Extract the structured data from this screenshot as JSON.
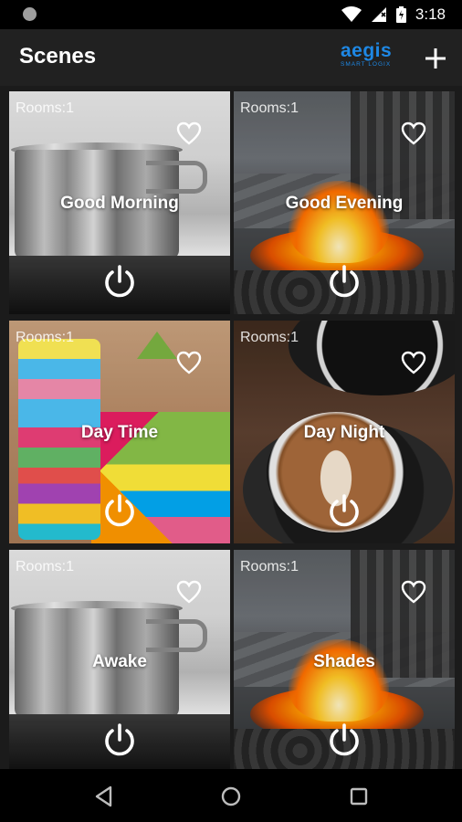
{
  "status_bar": {
    "time": "3:18"
  },
  "app_bar": {
    "title": "Scenes",
    "logo_main": "aegis",
    "logo_sub": "SMART LOGIX",
    "accent_color": "#1e88e5"
  },
  "scenes": [
    {
      "rooms": "Rooms:1",
      "name": "Good Morning",
      "image": "pot-on-stove"
    },
    {
      "rooms": "Rooms:1",
      "name": "Good Evening",
      "image": "fire-pit"
    },
    {
      "rooms": "Rooms:1",
      "name": "Day Time",
      "image": "toy-blocks"
    },
    {
      "rooms": "Rooms:1",
      "name": "Day Night",
      "image": "latte-cup"
    },
    {
      "rooms": "Rooms:1",
      "name": "Awake",
      "image": "pot-on-stove"
    },
    {
      "rooms": "Rooms:1",
      "name": "Shades",
      "image": "fire-pit"
    }
  ],
  "icons": {
    "add": "plus-icon",
    "favorite": "heart-outline-icon",
    "power": "power-icon",
    "nav_back": "back-triangle-icon",
    "nav_home": "home-circle-icon",
    "nav_recents": "recents-square-icon"
  }
}
